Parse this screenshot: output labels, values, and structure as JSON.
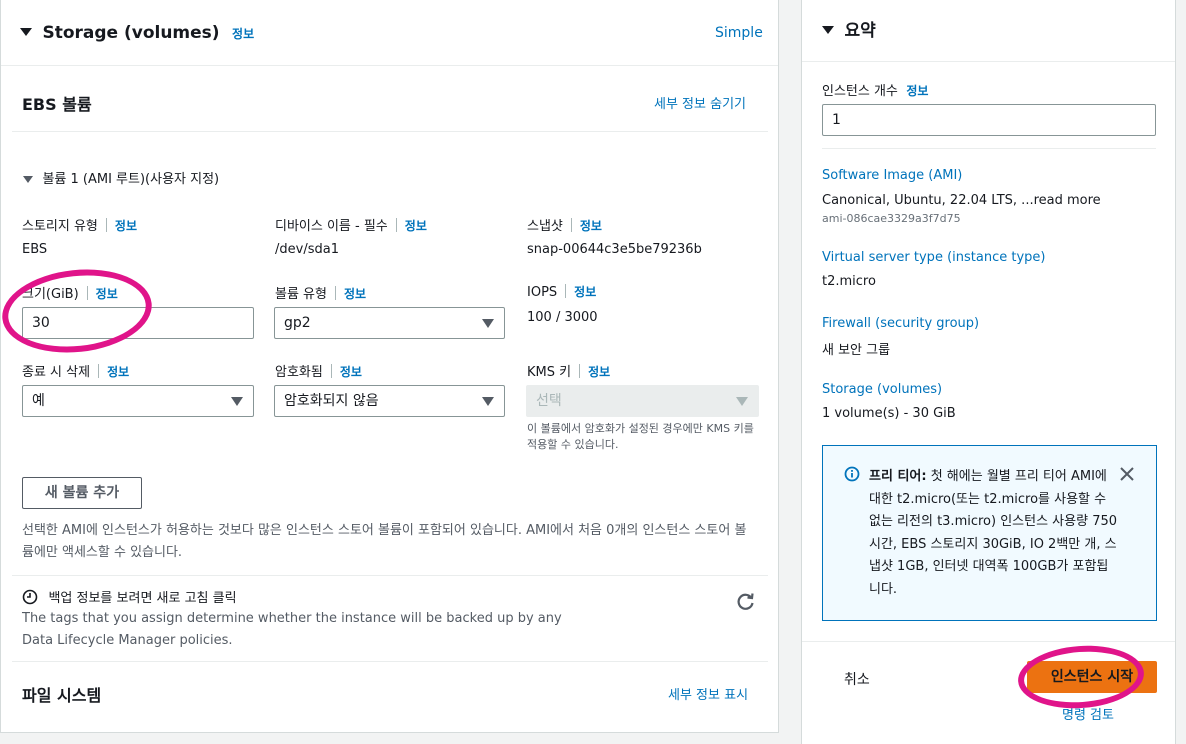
{
  "storage": {
    "title": "Storage (volumes)",
    "info": "정보",
    "simple_link": "Simple",
    "ebs_title": "EBS 볼륨",
    "hide_details": "세부 정보 숨기기",
    "volume_header": "볼륨 1 (AMI 루트)(사용자 지정)",
    "fields": {
      "storage_type_label": "스토리지 유형",
      "storage_type_value": "EBS",
      "device_name_label": "디바이스 이름 - 필수",
      "device_name_value": "/dev/sda1",
      "snapshot_label": "스냅샷",
      "snapshot_value": "snap-00644c3e5be79236b",
      "size_label": "크기(GiB)",
      "size_value": "30",
      "volume_type_label": "볼륨 유형",
      "volume_type_value": "gp2",
      "iops_label": "IOPS",
      "iops_value": "100 / 3000",
      "delete_on_term_label": "종료 시 삭제",
      "delete_on_term_value": "예",
      "encrypted_label": "암호화됨",
      "encrypted_value": "암호화되지 않음",
      "kms_label": "KMS 키",
      "kms_placeholder": "선택",
      "kms_help": "이 볼륨에서 암호화가 설정된 경우에만 KMS 키를 적용할 수 있습니다."
    },
    "add_volume_button": "새 볼륨 추가",
    "instance_store_note": "선택한 AMI에 인스턴스가 허용하는 것보다 많은 인스턴스 스토어 볼륨이 포함되어 있습니다. AMI에서 처음 0개의 인스턴스 스토어 볼륨에만 액세스할 수 있습니다.",
    "backup_title": "백업 정보를 보려면 새로 고침 클릭",
    "backup_desc": "The tags that you assign determine whether the instance will be backed up by any Data Lifecycle Manager policies.",
    "file_system_title": "파일 시스템",
    "show_details": "세부 정보 표시"
  },
  "summary": {
    "title": "요약",
    "instance_count_label": "인스턴스 개수",
    "info": "정보",
    "instance_count_value": "1",
    "ami_label": "Software Image (AMI)",
    "ami_value": "Canonical, Ubuntu, 22.04 LTS, ...",
    "ami_read_more": "read more",
    "ami_id": "ami-086cae3329a3f7d75",
    "instance_type_label": "Virtual server type (instance type)",
    "instance_type_value": "t2.micro",
    "firewall_label": "Firewall (security group)",
    "firewall_value": "새 보안 그룹",
    "storage_label": "Storage (volumes)",
    "storage_value": "1 volume(s) - 30 GiB",
    "free_tier_bold": "프리 티어:",
    "free_tier_text": " 첫 해에는 월별 프리 티어 AMI에 대한 t2.micro(또는 t2.micro를 사용할 수 없는 리전의 t3.micro) 인스턴스 사용량 750시간, EBS 스토리지 30GiB, IO 2백만 개, 스냅샷 1GB, 인터넷 대역폭 100GB가 포함됩니다.",
    "cancel_button": "취소",
    "launch_button": "인스턴스 시작",
    "review_commands": "명령 검토"
  },
  "colors": {
    "link": "#0073bb",
    "primary_button": "#ec7211",
    "annotation": "#e0148a",
    "alert_bg": "#f1faff"
  }
}
